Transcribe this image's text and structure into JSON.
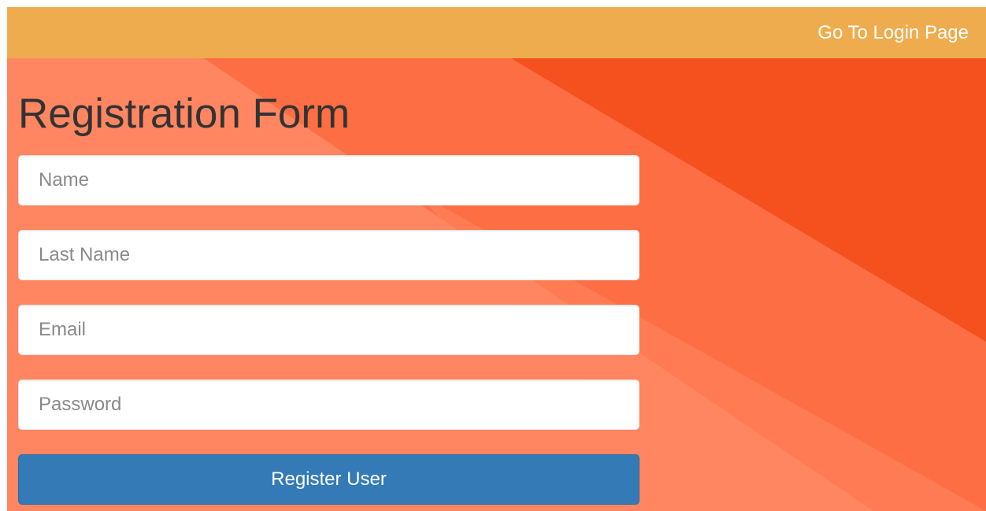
{
  "navbar": {
    "login_link": "Go To Login Page",
    "background_color": "#efac4e"
  },
  "form": {
    "title": "Registration Form",
    "fields": {
      "name": {
        "placeholder": "Name",
        "value": ""
      },
      "last_name": {
        "placeholder": "Last Name",
        "value": ""
      },
      "email": {
        "placeholder": "Email",
        "value": ""
      },
      "password": {
        "placeholder": "Password",
        "value": ""
      }
    },
    "submit_label": "Register User",
    "submit_color": "#337ab7"
  },
  "background": {
    "colors": [
      "#ff8661",
      "#fd6e44",
      "#f4511e"
    ]
  }
}
